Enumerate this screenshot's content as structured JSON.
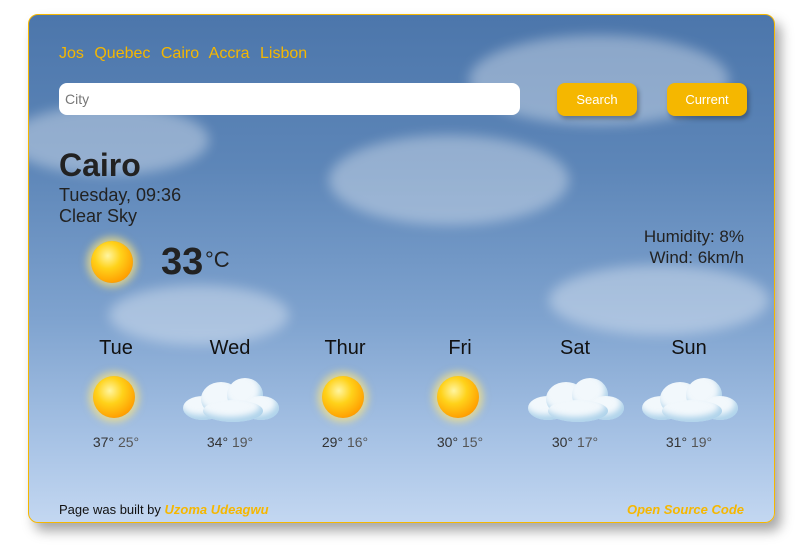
{
  "quick_cities": [
    "Jos",
    "Quebec",
    "Cairo",
    "Accra",
    "Lisbon"
  ],
  "search": {
    "placeholder": "City",
    "value": ""
  },
  "buttons": {
    "search_label": "Search",
    "current_label": "Current"
  },
  "current": {
    "city": "Cairo",
    "datetime": "Tuesday, 09:36",
    "description": "Clear Sky",
    "icon": "sun-icon",
    "temperature": "33",
    "unit": "°C",
    "humidity": "Humidity: 8%",
    "wind": "Wind: 6km/h"
  },
  "forecast": [
    {
      "day": "Tue",
      "icon": "sun-icon",
      "max": "37°",
      "min": "25°"
    },
    {
      "day": "Wed",
      "icon": "cloud-icon",
      "max": "34°",
      "min": "19°"
    },
    {
      "day": "Thur",
      "icon": "sun-icon",
      "max": "29°",
      "min": "16°"
    },
    {
      "day": "Fri",
      "icon": "sun-icon",
      "max": "30°",
      "min": "15°"
    },
    {
      "day": "Sat",
      "icon": "cloud-icon",
      "max": "30°",
      "min": "17°"
    },
    {
      "day": "Sun",
      "icon": "cloud-icon",
      "max": "31°",
      "min": "19°"
    }
  ],
  "footer": {
    "built_by_text": "Page was built by",
    "author": "Uzoma Udeagwu",
    "source_link": "Open Source Code"
  },
  "colors": {
    "accent": "#f5b700",
    "text": "#222222"
  }
}
